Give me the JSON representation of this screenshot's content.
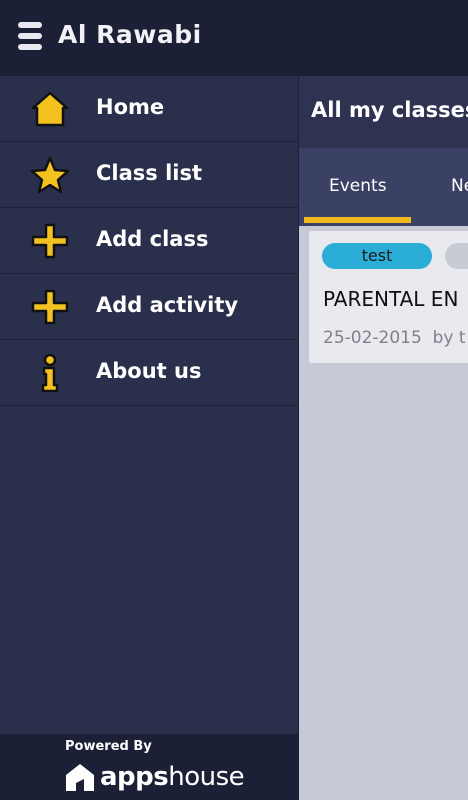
{
  "app": {
    "title": "Al Rawabi"
  },
  "sidebar": {
    "items": [
      {
        "label": "Home",
        "icon": "home-icon"
      },
      {
        "label": "Class list",
        "icon": "star-icon"
      },
      {
        "label": "Add class",
        "icon": "plus-icon"
      },
      {
        "label": "Add activity",
        "icon": "plus-icon"
      },
      {
        "label": "About us",
        "icon": "info-icon"
      }
    ],
    "footer": {
      "powered_by": "Powered By",
      "brand_a": "apps",
      "brand_b": "house"
    }
  },
  "main": {
    "title": "All my classes",
    "tabs": [
      {
        "label": "Events",
        "active": true
      },
      {
        "label": "Ne"
      }
    ],
    "card": {
      "tags": [
        "test",
        ""
      ],
      "title": "PARENTAL EN",
      "date": "25-02-2015",
      "by": "by t"
    }
  },
  "colors": {
    "accent": "#f3b81d",
    "tag_blue": "#2aaed8",
    "header_dark": "#1c2036"
  }
}
